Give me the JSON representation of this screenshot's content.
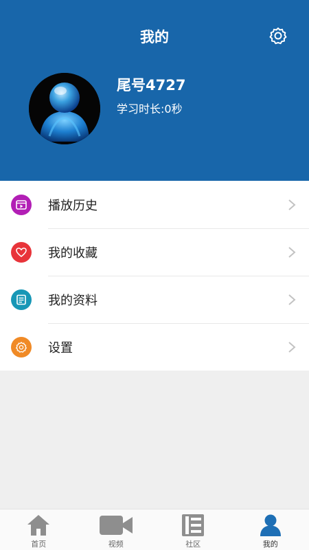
{
  "header": {
    "title": "我的",
    "settings_icon": "gear-icon",
    "accent_color": "#1866aa"
  },
  "profile": {
    "avatar_icon": "user-avatar",
    "username": "尾号4727",
    "study_time": "学习时长:0秒"
  },
  "menu": {
    "items": [
      {
        "label": "播放历史",
        "icon": "play-history-icon",
        "color": "#b21fb5"
      },
      {
        "label": "我的收藏",
        "icon": "heart-icon",
        "color": "#e8343a"
      },
      {
        "label": "我的资料",
        "icon": "document-icon",
        "color": "#1797b6"
      },
      {
        "label": "设置",
        "icon": "gear-icon",
        "color": "#f08a26"
      }
    ]
  },
  "tabbar": {
    "tabs": [
      {
        "label": "首页",
        "icon": "home-icon",
        "active": false
      },
      {
        "label": "视频",
        "icon": "video-camera-icon",
        "active": false
      },
      {
        "label": "社区",
        "icon": "community-icon",
        "active": false
      },
      {
        "label": "我的",
        "icon": "person-icon",
        "active": true
      }
    ],
    "active_color": "#1e6fb5",
    "inactive_color": "#8e8e8e"
  }
}
